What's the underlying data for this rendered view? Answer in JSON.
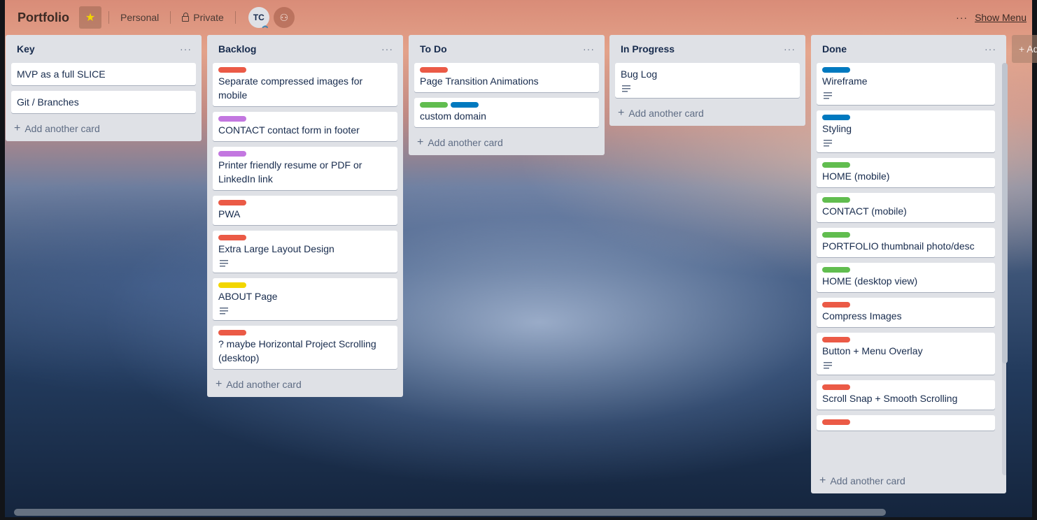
{
  "header": {
    "title": "Portfolio",
    "star_icon": "star-icon",
    "team": "Personal",
    "visibility": "Private",
    "avatar_initials": "TC",
    "show_menu_dots": "···",
    "show_menu": "Show Menu"
  },
  "add_list_label": "+ Add another list",
  "add_card_label": "Add another card",
  "list_menu_dots": "···",
  "colors": {
    "red": "#eb5a46",
    "purple": "#c377e0",
    "yellow": "#f2d600",
    "green": "#61bd4f",
    "blue": "#0079bf",
    "list_bg": "#dfe1e6"
  },
  "lists": [
    {
      "title": "Key",
      "cards": [
        {
          "title": "MVP as a full SLICE",
          "labels": [],
          "desc": false
        },
        {
          "title": "Git / Branches",
          "labels": [],
          "desc": false
        }
      ]
    },
    {
      "title": "Backlog",
      "cards": [
        {
          "title": "Separate compressed images for mobile",
          "labels": [
            "red"
          ],
          "desc": false
        },
        {
          "title": "CONTACT contact form in footer",
          "labels": [
            "purple"
          ],
          "desc": false
        },
        {
          "title": "Printer friendly resume or PDF or LinkedIn link",
          "labels": [
            "purple"
          ],
          "desc": false
        },
        {
          "title": "PWA",
          "labels": [
            "red"
          ],
          "desc": false
        },
        {
          "title": "Extra Large Layout Design",
          "labels": [
            "red"
          ],
          "desc": true
        },
        {
          "title": "ABOUT Page",
          "labels": [
            "yellow"
          ],
          "desc": true
        },
        {
          "title": "? maybe Horizontal Project Scrolling (desktop)",
          "labels": [
            "red"
          ],
          "desc": false
        }
      ]
    },
    {
      "title": "To Do",
      "cards": [
        {
          "title": "Page Transition Animations",
          "labels": [
            "red"
          ],
          "desc": false
        },
        {
          "title": "custom domain",
          "labels": [
            "green",
            "blue"
          ],
          "desc": false
        }
      ]
    },
    {
      "title": "In Progress",
      "cards": [
        {
          "title": "Bug Log",
          "labels": [],
          "desc": true
        }
      ]
    },
    {
      "title": "Done",
      "cards": [
        {
          "title": "Wireframe",
          "labels": [
            "blue"
          ],
          "desc": true
        },
        {
          "title": "Styling",
          "labels": [
            "blue"
          ],
          "desc": true
        },
        {
          "title": "HOME (mobile)",
          "labels": [
            "green"
          ],
          "desc": false
        },
        {
          "title": "CONTACT (mobile)",
          "labels": [
            "green"
          ],
          "desc": false
        },
        {
          "title": "PORTFOLIO thumbnail photo/desc",
          "labels": [
            "green"
          ],
          "desc": false
        },
        {
          "title": "HOME (desktop view)",
          "labels": [
            "green"
          ],
          "desc": false
        },
        {
          "title": "Compress Images",
          "labels": [
            "red"
          ],
          "desc": false
        },
        {
          "title": "Button + Menu Overlay",
          "labels": [
            "red"
          ],
          "desc": true
        },
        {
          "title": "Scroll Snap + Smooth Scrolling",
          "labels": [
            "red"
          ],
          "desc": false
        },
        {
          "title": "",
          "labels": [
            "red"
          ],
          "desc": false
        }
      ]
    }
  ]
}
